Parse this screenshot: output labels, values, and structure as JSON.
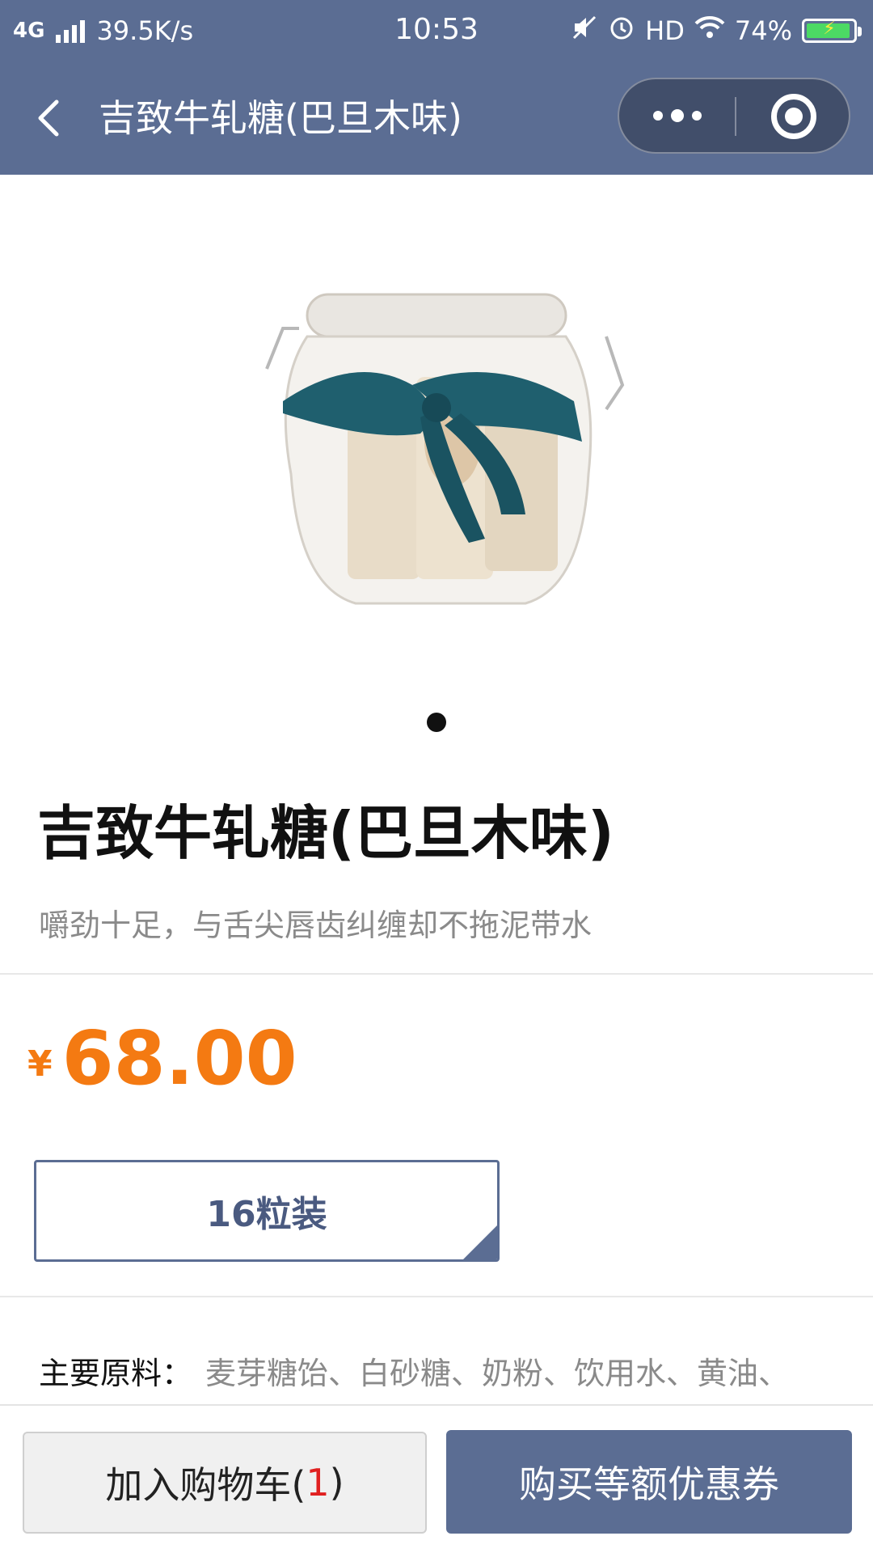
{
  "status_bar": {
    "network": "4G",
    "speed": "39.5K/s",
    "time": "10:53",
    "hd": "HD",
    "battery": "74%"
  },
  "nav": {
    "title": "吉致牛轧糖(巴旦木味)",
    "icons": [
      "back-icon",
      "more-icon",
      "close-capsule-icon"
    ]
  },
  "gallery": {
    "image_count": 1,
    "active_index": 1
  },
  "product": {
    "title": "吉致牛轧糖(巴旦木味)",
    "subtitle": "嚼劲十足，与舌尖唇齿纠缠却不拖泥带水",
    "price_currency": "¥",
    "price": "68.00",
    "spec": "16粒装",
    "ingredients_label": "主要原料：",
    "ingredients": "麦芽糖饴、白砂糖、奶粉、饮用水、黄油、"
  },
  "actions": {
    "cart_label": "加入购物车(",
    "cart_count": "1",
    "cart_suffix": ")",
    "buy_label": "购买等额优惠券"
  },
  "colors": {
    "header": "#5b6d93",
    "price": "#f47a12",
    "cart_count": "#e02020"
  }
}
